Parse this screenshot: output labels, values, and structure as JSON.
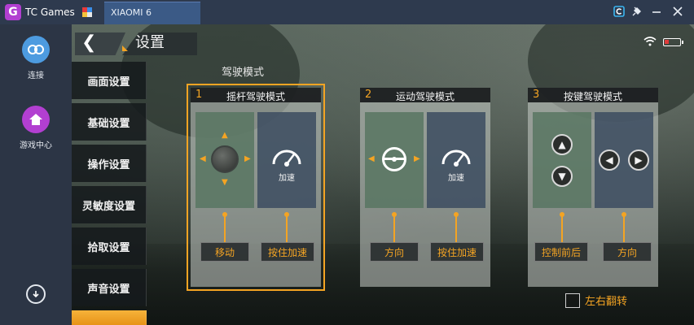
{
  "app": {
    "name": "TC Games",
    "device_tab": "XIAOMI 6"
  },
  "window_controls": [
    "tc-icon",
    "pin-icon",
    "minimize-icon",
    "close-icon"
  ],
  "sidebar": {
    "items": [
      {
        "label": "连接",
        "icon": "link-icon",
        "color": "#4d9be0"
      },
      {
        "label": "游戏中心",
        "icon": "home-icon",
        "color": "#b23fd1"
      }
    ],
    "download_icon": "download-icon"
  },
  "settings": {
    "title": "设置",
    "back_icon": "chevron-left-icon",
    "status": {
      "wifi_icon": "wifi-icon",
      "battery_icon": "battery-icon"
    },
    "menu": [
      {
        "label": "画面设置",
        "active": false
      },
      {
        "label": "基础设置",
        "active": false
      },
      {
        "label": "操作设置",
        "active": false
      },
      {
        "label": "灵敏度设置",
        "active": false
      },
      {
        "label": "拾取设置",
        "active": false
      },
      {
        "label": "声音设置",
        "active": false
      },
      {
        "label": "",
        "active": true
      }
    ],
    "section_label": "驾驶模式",
    "modes": [
      {
        "num": "1",
        "name": "摇杆驾驶模式",
        "selected": true,
        "left_icon": "joystick-icon",
        "right_icon": "speedometer-icon",
        "right_caption": "加速",
        "buttons": [
          "移动",
          "按住加速"
        ]
      },
      {
        "num": "2",
        "name": "运动驾驶模式",
        "selected": false,
        "left_icon": "steering-wheel-icon",
        "right_icon": "speedometer-icon",
        "right_caption": "加速",
        "buttons": [
          "方向",
          "按住加速"
        ]
      },
      {
        "num": "3",
        "name": "按键驾驶模式",
        "selected": false,
        "left_icon": "up-down-buttons-icon",
        "right_icon": "left-right-buttons-icon",
        "buttons": [
          "控制前后",
          "方向"
        ]
      }
    ],
    "flip": {
      "label": "左右翻转",
      "checked": false
    },
    "accent_color": "#f4a423"
  }
}
